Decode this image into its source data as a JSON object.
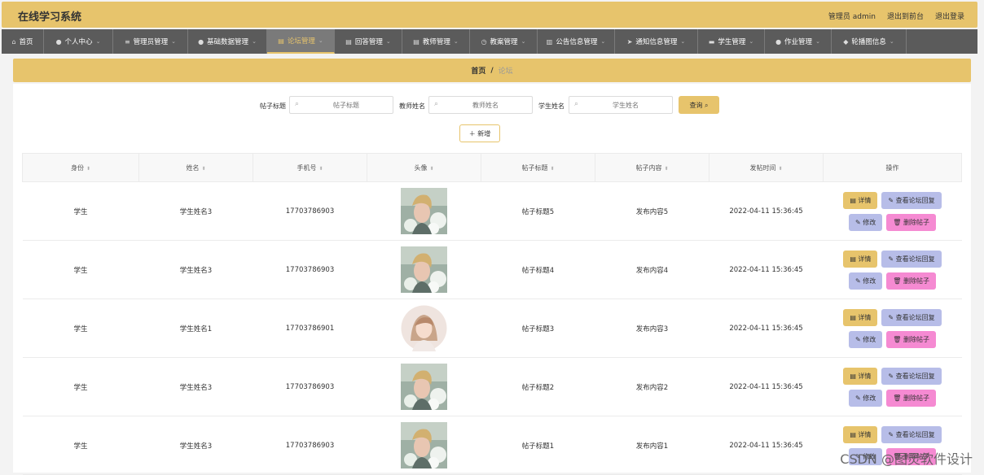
{
  "app": {
    "title": "在线学习系统"
  },
  "top_links": {
    "user": "管理员 admin",
    "front": "退出到前台",
    "logout": "退出登录"
  },
  "nav": [
    {
      "label": "首页",
      "icon": "home-icon",
      "glyph": "⌂",
      "width": 52,
      "caret": false
    },
    {
      "label": "个人中心",
      "icon": "user-icon",
      "glyph": "●",
      "width": 85,
      "caret": true
    },
    {
      "label": "管理员管理",
      "icon": "list-icon",
      "glyph": "≡",
      "width": 92,
      "caret": true
    },
    {
      "label": "基础数据管理",
      "icon": "user-icon",
      "glyph": "●",
      "width": 97,
      "caret": true
    },
    {
      "label": "论坛管理",
      "icon": "doc-icon",
      "glyph": "▤",
      "width": 83,
      "caret": true,
      "active": true
    },
    {
      "label": "回答管理",
      "icon": "doc-icon",
      "glyph": "▤",
      "width": 83,
      "caret": true
    },
    {
      "label": "教师管理",
      "icon": "doc-icon",
      "glyph": "▤",
      "width": 83,
      "caret": true
    },
    {
      "label": "教案管理",
      "icon": "clock-icon",
      "glyph": "◷",
      "width": 83,
      "caret": true
    },
    {
      "label": "公告信息管理",
      "icon": "chart-icon",
      "glyph": "▥",
      "width": 95,
      "caret": true
    },
    {
      "label": "通知信息管理",
      "icon": "send-icon",
      "glyph": "➤",
      "width": 102,
      "caret": true
    },
    {
      "label": "学生管理",
      "icon": "card-icon",
      "glyph": "▬",
      "width": 82,
      "caret": true
    },
    {
      "label": "作业管理",
      "icon": "user-icon",
      "glyph": "●",
      "width": 82,
      "caret": true
    },
    {
      "label": "轮播图信息",
      "icon": "location-icon",
      "glyph": "◆",
      "width": 92,
      "caret": true
    }
  ],
  "breadcrumb": {
    "home": "首页",
    "sep": "/",
    "current": "论坛"
  },
  "search": {
    "title_label": "帖子标题",
    "title_placeholder": "帖子标题",
    "teacher_label": "教师姓名",
    "teacher_placeholder": "教师姓名",
    "student_label": "学生姓名",
    "student_placeholder": "学生姓名",
    "query_button": "查询 ⌕"
  },
  "add_button": "＋ 新增",
  "table": {
    "columns": [
      "身份",
      "姓名",
      "手机号",
      "头像",
      "帖子标题",
      "帖子内容",
      "发帖时间",
      "操作"
    ],
    "sort_glyph": "⬍",
    "rows": [
      {
        "identity": "学生",
        "name": "学生姓名3",
        "phone": "17703786903",
        "avatar": "avatar-boy",
        "title": "帖子标题5",
        "content": "发布内容5",
        "time": "2022-04-11 15:36:45"
      },
      {
        "identity": "学生",
        "name": "学生姓名3",
        "phone": "17703786903",
        "avatar": "avatar-boy",
        "title": "帖子标题4",
        "content": "发布内容4",
        "time": "2022-04-11 15:36:45"
      },
      {
        "identity": "学生",
        "name": "学生姓名1",
        "phone": "17703786901",
        "avatar": "avatar-girl",
        "title": "帖子标题3",
        "content": "发布内容3",
        "time": "2022-04-11 15:36:45"
      },
      {
        "identity": "学生",
        "name": "学生姓名3",
        "phone": "17703786903",
        "avatar": "avatar-boy",
        "title": "帖子标题2",
        "content": "发布内容2",
        "time": "2022-04-11 15:36:45"
      },
      {
        "identity": "学生",
        "name": "学生姓名3",
        "phone": "17703786903",
        "avatar": "avatar-boy",
        "title": "帖子标题1",
        "content": "发布内容1",
        "time": "2022-04-11 15:36:45"
      }
    ],
    "actions": {
      "detail": "▤ 详情",
      "reply": "✎ 查看论坛回复",
      "edit": "✎ 修改",
      "delete": "🗑 删除帖子"
    }
  },
  "watermark": "CSDN @图灵软件设计"
}
